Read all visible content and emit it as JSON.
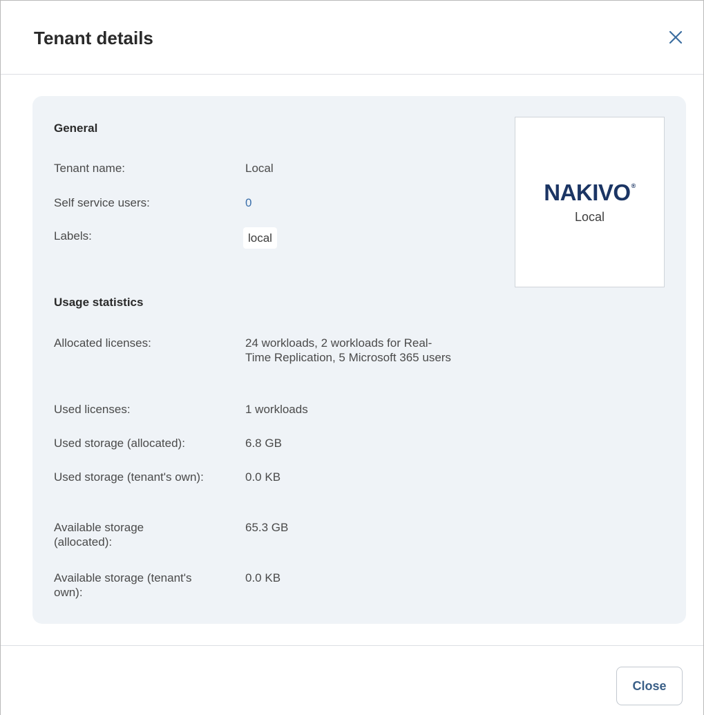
{
  "dialog": {
    "title": "Tenant details",
    "close_icon": "close-icon"
  },
  "general": {
    "title": "General",
    "rows": [
      {
        "label": "Tenant name:",
        "value": "Local"
      },
      {
        "label": "Self service users:",
        "value": "0"
      },
      {
        "label": "Labels:",
        "value": "local"
      }
    ]
  },
  "logo": {
    "brand": "NAKIVO",
    "registered": "®",
    "subtitle": "Local"
  },
  "usage": {
    "title": "Usage statistics",
    "rows": [
      {
        "label": "Allocated licenses:",
        "value": "24 workloads, 2 workloads for Real-Time Replication, 5 Microsoft 365 users"
      },
      {
        "label": "Used licenses:",
        "value": "1 workloads"
      },
      {
        "label": "Used storage (allocated):",
        "value": "6.8 GB"
      },
      {
        "label": "Used storage (tenant's own):",
        "value": "0.0 KB"
      },
      {
        "label": "Available storage (allocated):",
        "value": "65.3 GB"
      },
      {
        "label": "Available storage (tenant's own):",
        "value": "0.0 KB"
      }
    ]
  },
  "footer": {
    "close_label": "Close"
  },
  "colors": {
    "panel_bg": "#eff3f7",
    "link": "#3a6eaa",
    "brand": "#1b3564",
    "button_text": "#3a5f87"
  }
}
